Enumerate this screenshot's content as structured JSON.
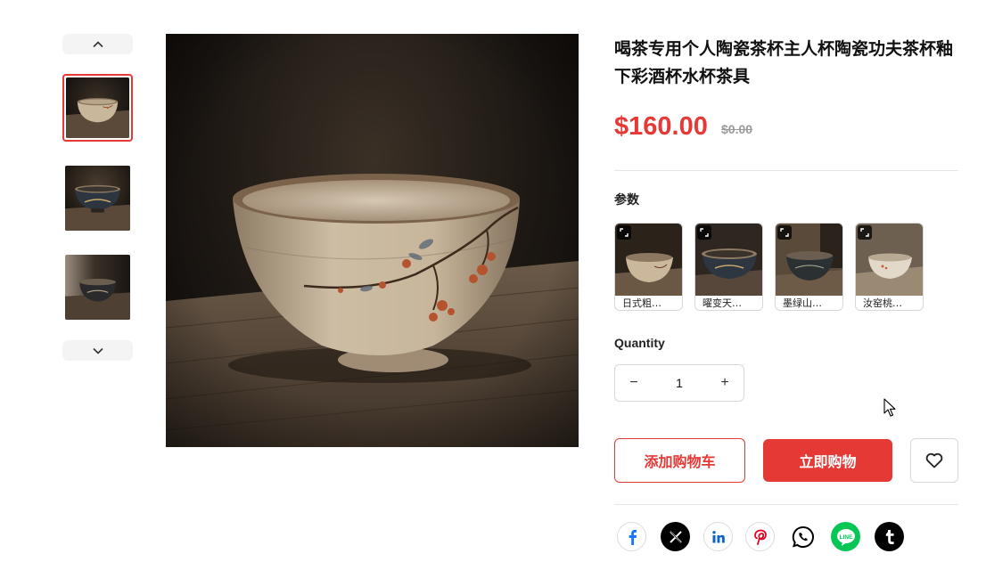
{
  "product": {
    "title": "喝茶专用个人陶瓷茶杯主人杯陶瓷功夫茶杯釉下彩酒杯水杯茶具",
    "price": "$160.00",
    "compare_price": "$0.00"
  },
  "gallery": {
    "active_index": 0,
    "thumbnail_count": 3
  },
  "options": {
    "label": "参数",
    "variants": [
      {
        "label": "日式粗…"
      },
      {
        "label": "曜变天…"
      },
      {
        "label": "墨绿山…"
      },
      {
        "label": "汝窑桃…"
      }
    ]
  },
  "quantity": {
    "label": "Quantity",
    "value": "1",
    "decrement": "−",
    "increment": "+"
  },
  "actions": {
    "add_to_cart": "添加购物车",
    "buy_now": "立即购物"
  },
  "share": [
    "facebook",
    "x",
    "linkedin",
    "pinterest",
    "whatsapp",
    "line",
    "tumblr"
  ],
  "colors": {
    "accent": "#e53935",
    "facebook": "#1877f2",
    "linkedin": "#0a66c2",
    "pinterest": "#e60023",
    "line": "#06c755"
  }
}
